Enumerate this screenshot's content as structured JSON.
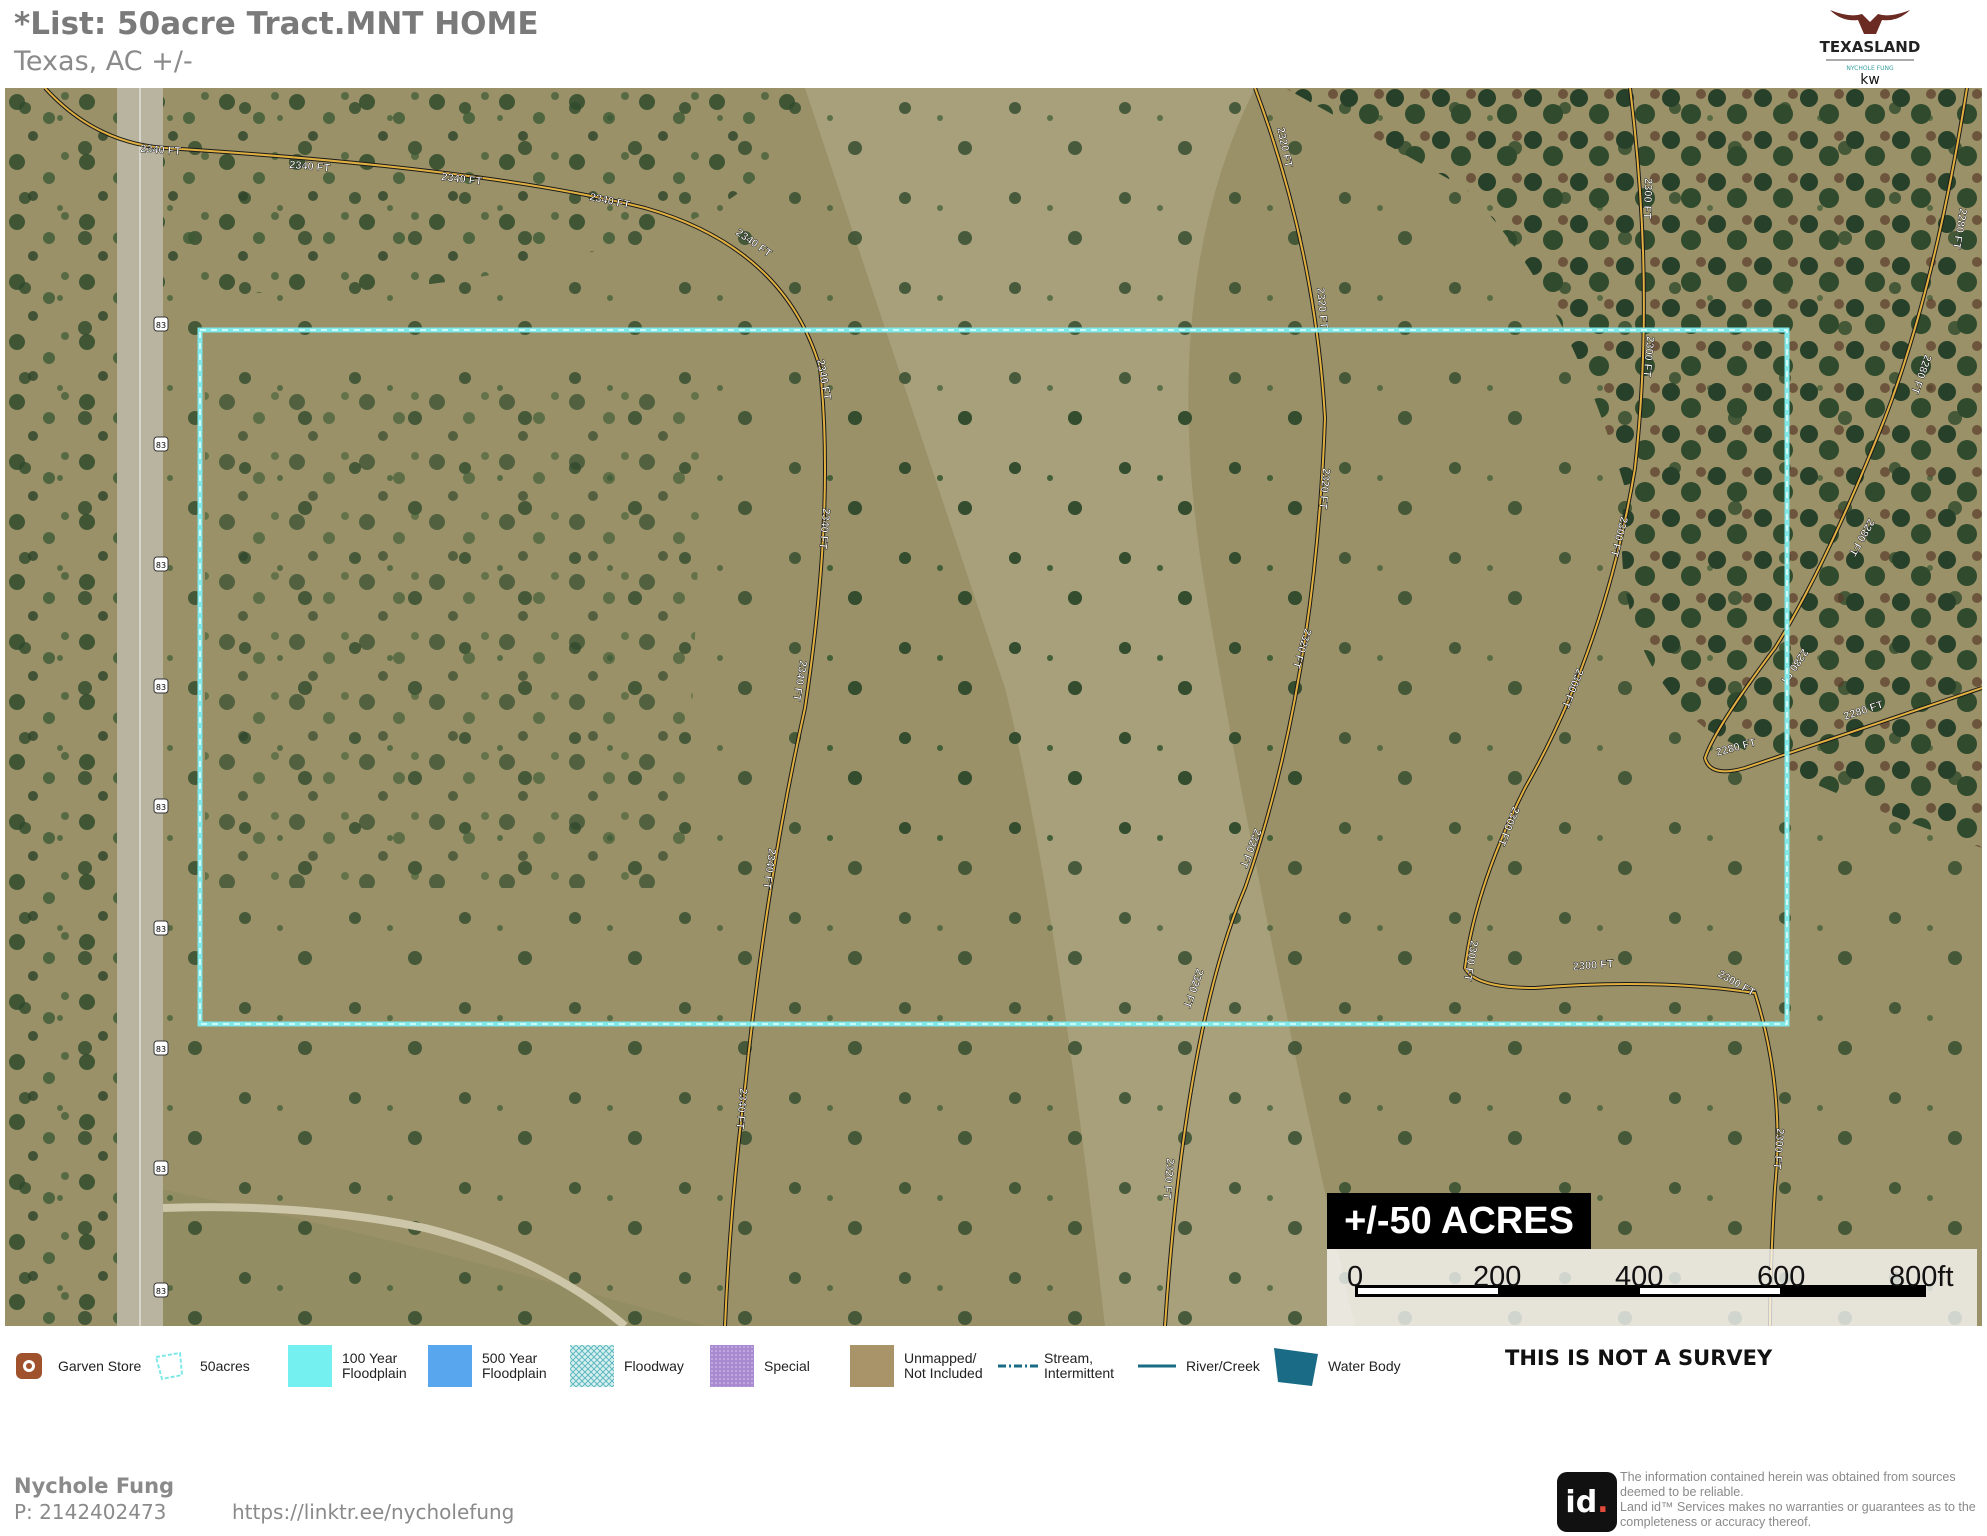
{
  "header": {
    "title": "*List: 50acre Tract.MNT HOME",
    "subtitle": "Texas,  AC +/-"
  },
  "logo": {
    "brand_text": "TEXASLAND",
    "agent_text": "NYCHOLE FUNG",
    "kw_text": "kw"
  },
  "map": {
    "acres_label": "+/-50 ACRES",
    "scale_labels": [
      "0",
      "200",
      "400",
      "600",
      "800ft"
    ],
    "contour_labels": {
      "c2340": "2340 FT",
      "c2320": "2320 FT",
      "c2300": "2300 FT",
      "c2280": "2280 FT"
    },
    "highway_shield": "83",
    "colors": {
      "boundary": "#7fe8e8",
      "contour": "#d9a83a",
      "terrain": "#9a9168",
      "tree": "#2f4a2c"
    }
  },
  "legend": [
    {
      "icon": "store-icon",
      "label": "Garven Store"
    },
    {
      "icon": "parcel-outline-icon",
      "label": "50acres"
    },
    {
      "icon": "swatch-100yr-icon",
      "label": "100 Year\nFloodplain"
    },
    {
      "icon": "swatch-500yr-icon",
      "label": "500 Year\nFloodplain"
    },
    {
      "icon": "swatch-floodway-icon",
      "label": "Floodway"
    },
    {
      "icon": "swatch-special-icon",
      "label": "Special"
    },
    {
      "icon": "swatch-unmapped-icon",
      "label": "Unmapped/\nNot Included"
    },
    {
      "icon": "stream-line-icon",
      "label": "Stream,\nIntermittent"
    },
    {
      "icon": "river-line-icon",
      "label": "River/Creek"
    },
    {
      "icon": "water-body-icon",
      "label": "Water Body"
    }
  ],
  "survey_notice": "THIS IS NOT A SURVEY",
  "agent": {
    "name": "Nychole Fung",
    "phone": "P: 2142402473",
    "link": "https://linktr.ee/nycholefung"
  },
  "landid": {
    "logo_main": "id",
    "logo_dot": ".",
    "footnote": "The information contained herein was obtained from sources deemed to be reliable.\n Land id™ Services makes no warranties or guarantees as to the completeness or accuracy thereof."
  }
}
